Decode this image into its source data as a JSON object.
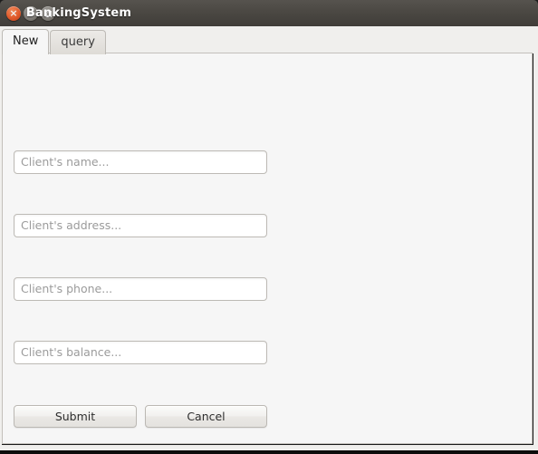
{
  "window": {
    "title": "BankingSystem",
    "controls": [
      {
        "name": "close",
        "glyph": "×"
      },
      {
        "name": "minimize",
        "glyph": "−"
      },
      {
        "name": "maximize",
        "glyph": "□"
      }
    ]
  },
  "tabs": [
    {
      "label": "New",
      "active": true
    },
    {
      "label": "query",
      "active": false
    }
  ],
  "form": {
    "fields": [
      {
        "name": "client-name",
        "placeholder": "Client's name...",
        "value": ""
      },
      {
        "name": "client-address",
        "placeholder": "Client's address...",
        "value": ""
      },
      {
        "name": "client-phone",
        "placeholder": "Client's phone...",
        "value": ""
      },
      {
        "name": "client-balance",
        "placeholder": "Client's balance...",
        "value": ""
      }
    ],
    "buttons": {
      "submit": "Submit",
      "cancel": "Cancel"
    }
  },
  "colors": {
    "titlebar": "#4a4742",
    "tabstrip": "#f0efed",
    "panel": "#f6f6f6",
    "border": "#c3c0bb",
    "placeholder": "#9b9b9b",
    "close_button": "#e0592a"
  }
}
